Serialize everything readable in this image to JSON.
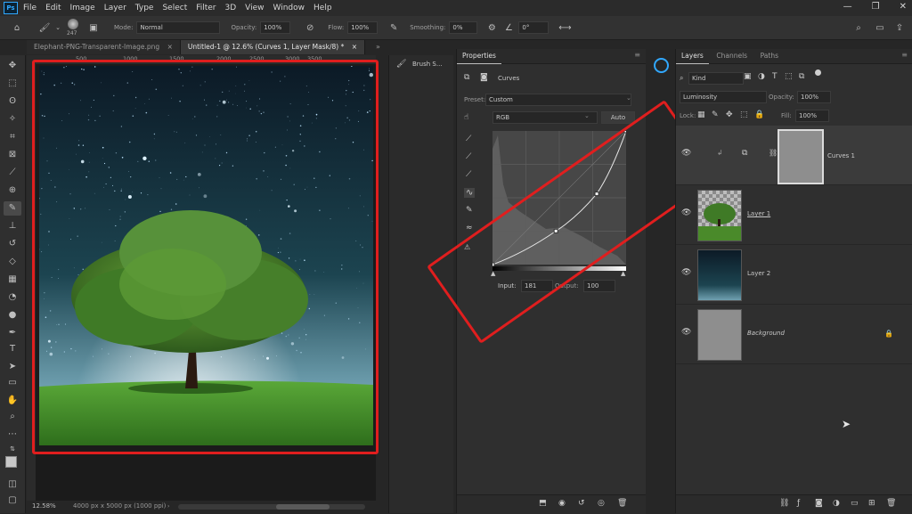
{
  "menu": {
    "app_icon": "Ps",
    "items": [
      "File",
      "Edit",
      "Image",
      "Layer",
      "Type",
      "Select",
      "Filter",
      "3D",
      "View",
      "Window",
      "Help"
    ]
  },
  "options_bar": {
    "brush_size": "247",
    "mode_label": "Mode:",
    "mode_value": "Normal",
    "opacity_label": "Opacity:",
    "opacity_value": "100%",
    "flow_label": "Flow:",
    "flow_value": "100%",
    "smoothing_label": "Smoothing:",
    "smoothing_value": "0%",
    "angle_value": "0°"
  },
  "tabs": [
    {
      "label": "Elephant-PNG-Transparent-Image.png",
      "close": "×"
    },
    {
      "label": "Untitled-1 @ 12.6% (Curves 1, Layer Mask/8) *",
      "close": "×"
    }
  ],
  "ruler": {
    "ticks": [
      "500",
      "1000",
      "1500",
      "2000",
      "2500",
      "3000",
      "3500"
    ]
  },
  "status": {
    "zoom": "12.58%",
    "doc_size": "4000 px x 5000 px (1000 ppi)"
  },
  "brush_panel": {
    "title": "Brush S..."
  },
  "properties": {
    "tab": "Properties",
    "type_label": "Curves",
    "preset_label": "Preset:",
    "preset_value": "Custom",
    "channel_value": "RGB",
    "auto_label": "Auto",
    "input_label": "Input:",
    "input_value": "181",
    "output_label": "Output:",
    "output_value": "100"
  },
  "curve": {
    "points": [
      [
        0,
        0
      ],
      [
        121,
        64
      ],
      [
        199,
        135
      ],
      [
        255,
        255
      ]
    ]
  },
  "layers_panel": {
    "tabs": [
      "Layers",
      "Channels",
      "Paths"
    ],
    "filter_value": "Kind",
    "blend_value": "Luminosity",
    "opacity_label": "Opacity:",
    "opacity_value": "100%",
    "lock_label": "Lock:",
    "fill_label": "Fill:",
    "fill_value": "100%",
    "layers": [
      {
        "name": "Curves 1",
        "selected": true
      },
      {
        "name": "Layer 1",
        "selected": false
      },
      {
        "name": "Layer 2",
        "selected": false
      },
      {
        "name": "Background",
        "selected": false
      }
    ]
  },
  "colors": {
    "highlight": "#e01e1e",
    "accent": "#31a8ff"
  }
}
